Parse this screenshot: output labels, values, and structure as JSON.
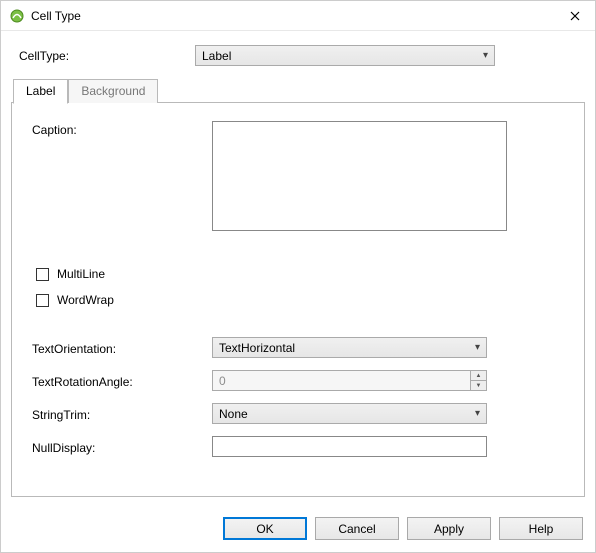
{
  "window": {
    "title": "Cell Type"
  },
  "top": {
    "celltype_label": "CellType:",
    "celltype_value": "Label"
  },
  "tabs": {
    "label": "Label",
    "background": "Background"
  },
  "form": {
    "caption_label": "Caption:",
    "caption_value": "",
    "multiline_label": "MultiLine",
    "multiline_checked": false,
    "wordwrap_label": "WordWrap",
    "wordwrap_checked": false,
    "textorientation_label": "TextOrientation:",
    "textorientation_value": "TextHorizontal",
    "textrotation_label": "TextRotationAngle:",
    "textrotation_value": "0",
    "stringtrim_label": "StringTrim:",
    "stringtrim_value": "None",
    "nulldisplay_label": "NullDisplay:",
    "nulldisplay_value": ""
  },
  "buttons": {
    "ok": "OK",
    "cancel": "Cancel",
    "apply": "Apply",
    "help": "Help"
  }
}
